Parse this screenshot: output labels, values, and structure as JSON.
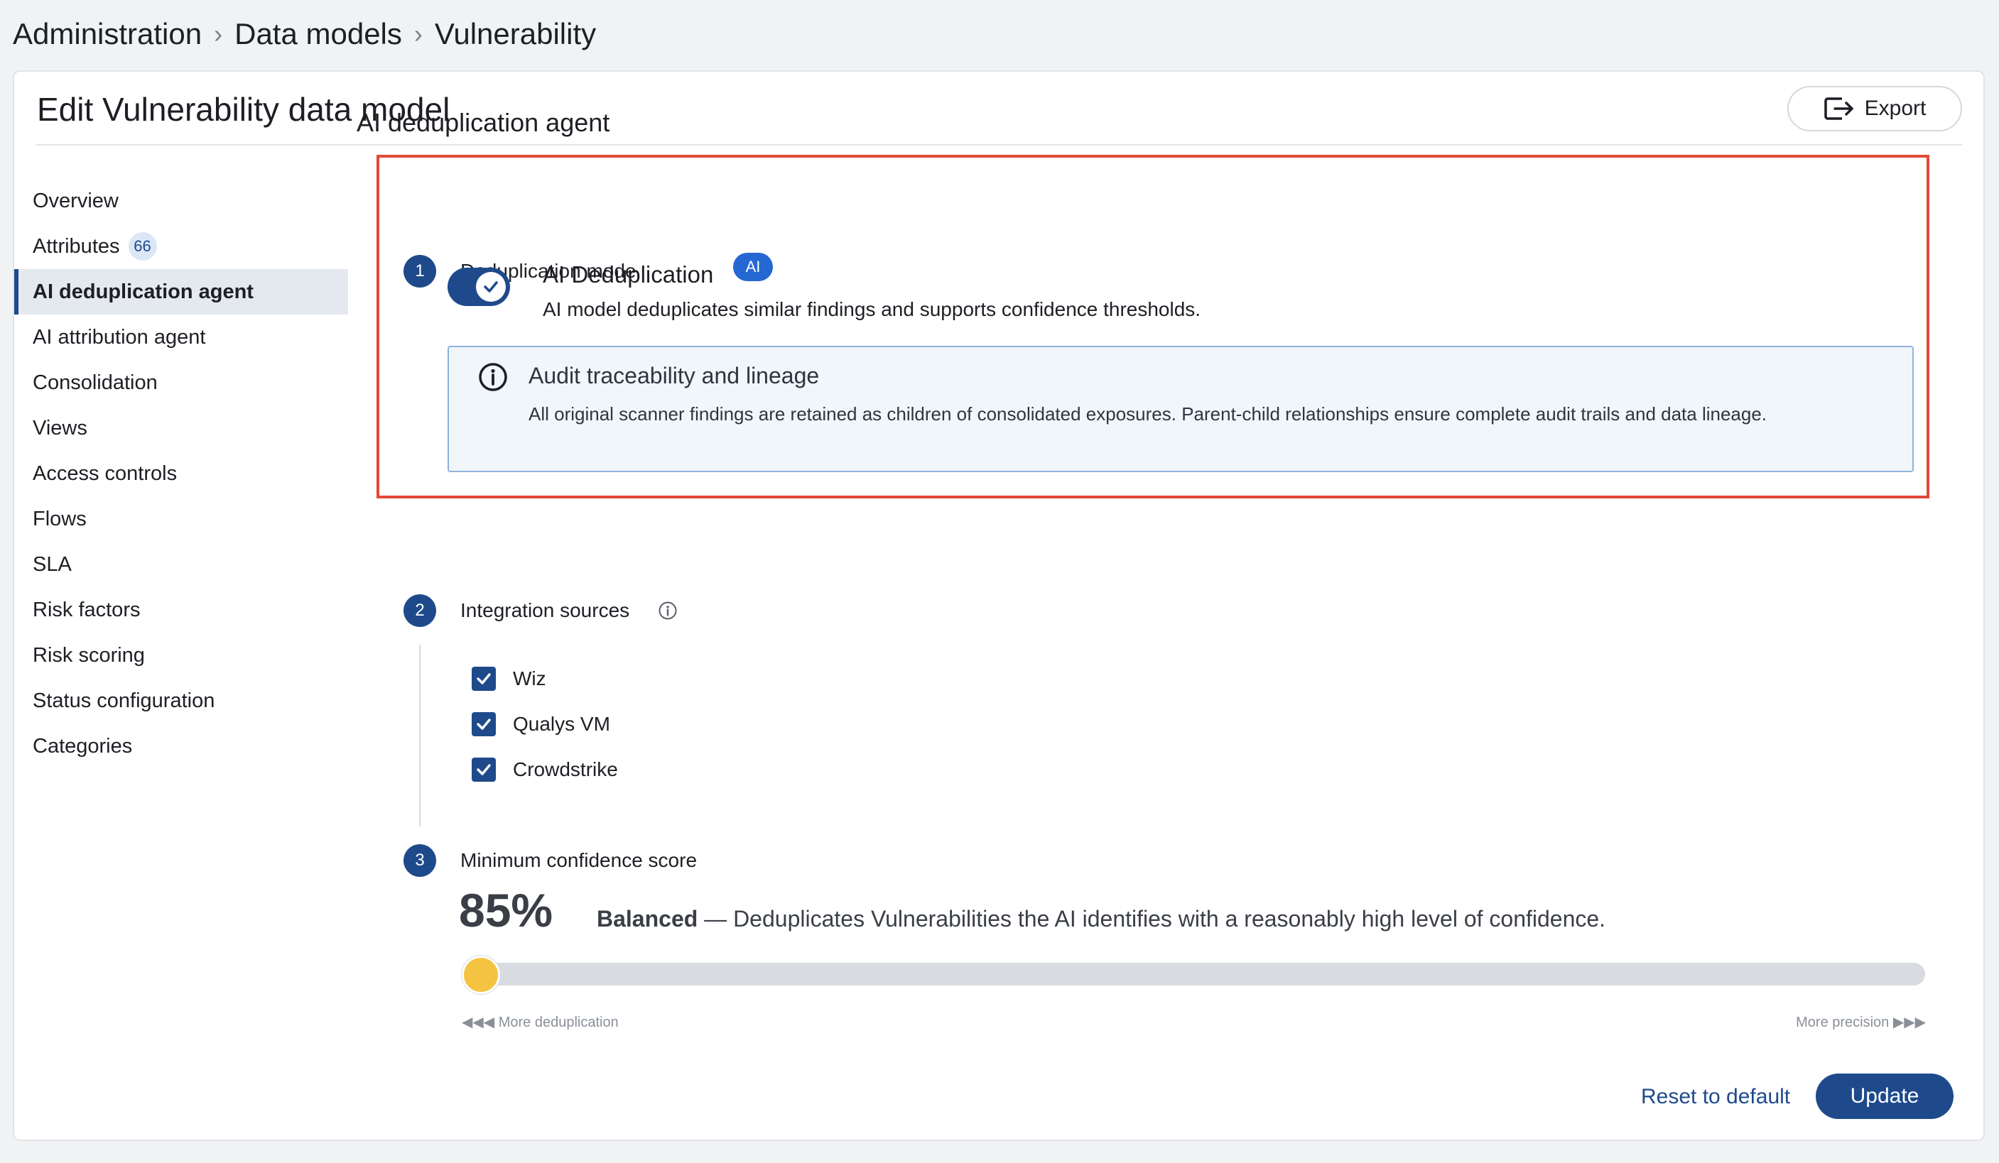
{
  "breadcrumb": {
    "items": [
      "Administration",
      "Data models",
      "Vulnerability"
    ]
  },
  "page": {
    "title": "Edit Vulnerability data model",
    "export_label": "Export"
  },
  "sidebar": {
    "items": [
      {
        "label": "Overview"
      },
      {
        "label": "Attributes",
        "badge": "66"
      },
      {
        "label": "AI deduplication agent"
      },
      {
        "label": "AI attribution agent"
      },
      {
        "label": "Consolidation"
      },
      {
        "label": "Views"
      },
      {
        "label": "Access controls"
      },
      {
        "label": "Flows"
      },
      {
        "label": "SLA"
      },
      {
        "label": "Risk factors"
      },
      {
        "label": "Risk scoring"
      },
      {
        "label": "Status configuration"
      },
      {
        "label": "Categories"
      }
    ],
    "active_index": 2
  },
  "main": {
    "heading": "AI deduplication agent",
    "steps": [
      {
        "number": "1",
        "label": "Deduplication mode"
      },
      {
        "number": "2",
        "label": "Integration sources"
      },
      {
        "number": "3",
        "label": "Minimum confidence score"
      }
    ],
    "dedup": {
      "toggle_on": true,
      "title": "AI Deduplication",
      "badge": "AI",
      "description": "AI model deduplicates similar findings and supports confidence thresholds."
    },
    "info": {
      "title": "Audit traceability and lineage",
      "text": "All original scanner findings are retained as children of consolidated exposures. Parent-child relationships ensure complete audit trails and data lineage."
    },
    "sources": [
      {
        "label": "Wiz",
        "checked": true
      },
      {
        "label": "Qualys VM",
        "checked": true
      },
      {
        "label": "Crowdstrike",
        "checked": true
      }
    ],
    "confidence": {
      "value_label": "85%",
      "level": "Balanced",
      "description": " — Deduplicates Vulnerabilities the AI identifies with a reasonably high level of confidence.",
      "slider_position": 0,
      "scale_left": "◀◀◀ More deduplication",
      "scale_right": "More precision ▶▶▶"
    },
    "actions": {
      "reset_label": "Reset to default",
      "update_label": "Update"
    }
  },
  "colors": {
    "accent": "#1e4a8c",
    "highlight_border": "#e14a36",
    "ai_badge": "#2567d3",
    "slider_thumb": "#f5c342"
  }
}
